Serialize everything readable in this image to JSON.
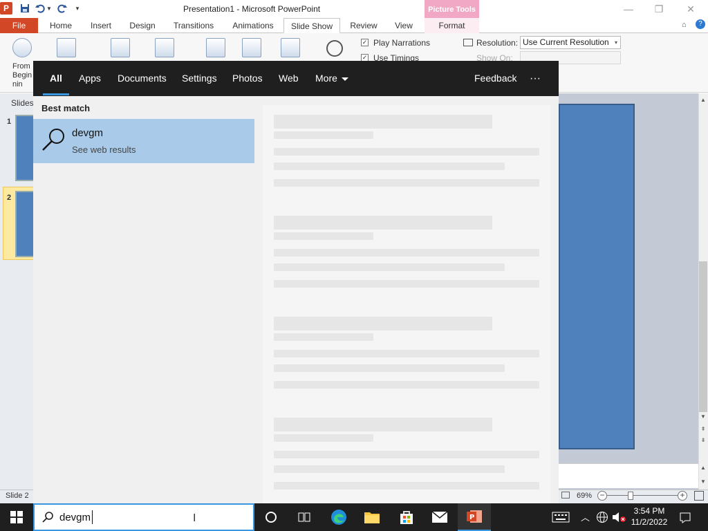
{
  "window": {
    "title": "Presentation1 - Microsoft PowerPoint",
    "minimize": "—",
    "maximize": "❐",
    "close": "✕"
  },
  "qat": {
    "save_icon": "save-icon",
    "undo_icon": "undo-icon",
    "redo_icon": "redo-icon",
    "customize_icon": "customize-qat-icon"
  },
  "contextual_tab": {
    "header": "Picture Tools"
  },
  "ribbon": {
    "tabs": [
      {
        "label": "File"
      },
      {
        "label": "Home"
      },
      {
        "label": "Insert"
      },
      {
        "label": "Design"
      },
      {
        "label": "Transitions"
      },
      {
        "label": "Animations"
      },
      {
        "label": "Slide Show"
      },
      {
        "label": "Review"
      },
      {
        "label": "View"
      },
      {
        "label": "Format"
      }
    ],
    "active_tab": "Slide Show",
    "from_beginning_label": "From Beginnin",
    "play_narrations_label": "Play Narrations",
    "use_timings_label": "Use Timings",
    "resolution_label": "Resolution:",
    "resolution_value": "Use Current Resolution",
    "show_on_label": "Show On:"
  },
  "slides_panel": {
    "label": "Slides",
    "slides": [
      {
        "num": "1"
      },
      {
        "num": "2"
      }
    ]
  },
  "status": {
    "slide_info": "Slide 2",
    "zoom": "69%"
  },
  "search": {
    "tabs": [
      {
        "label": "All"
      },
      {
        "label": "Apps"
      },
      {
        "label": "Documents"
      },
      {
        "label": "Settings"
      },
      {
        "label": "Photos"
      },
      {
        "label": "Web"
      },
      {
        "label": "More"
      }
    ],
    "feedback": "Feedback",
    "more_options": "···",
    "best_match_heading": "Best match",
    "best_match": {
      "title": "devgm",
      "subtitle": "See web results",
      "icon": "search-icon"
    },
    "query": "devgm",
    "accent_color": "#3a96dd",
    "highlight_color": "#a9cbe9"
  },
  "taskbar": {
    "time": "3:54 PM",
    "date": "11/2/2022",
    "icons": [
      "windows-start-icon",
      "cortana-icon",
      "task-view-icon",
      "edge-icon",
      "file-explorer-icon",
      "store-icon",
      "mail-icon",
      "powerpoint-icon"
    ]
  }
}
